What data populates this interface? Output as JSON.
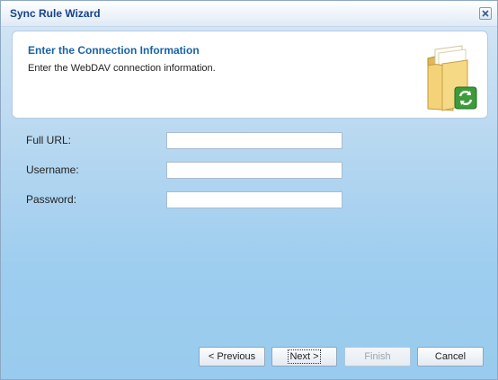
{
  "window": {
    "title": "Sync Rule Wizard",
    "close_icon": "close-icon"
  },
  "header": {
    "title": "Enter the Connection Information",
    "subtitle": "Enter the WebDAV connection information.",
    "icon": "folder-sync-icon"
  },
  "form": {
    "fields": [
      {
        "label": "Full URL:",
        "value": "",
        "placeholder": ""
      },
      {
        "label": "Username:",
        "value": "",
        "placeholder": ""
      },
      {
        "label": "Password:",
        "value": "",
        "placeholder": ""
      }
    ]
  },
  "buttons": {
    "previous": "< Previous",
    "next": "Next >",
    "finish": "Finish",
    "cancel": "Cancel"
  },
  "colors": {
    "title_text": "#15428b",
    "header_title": "#1a63a5",
    "background_bottom": "#99cbee"
  }
}
